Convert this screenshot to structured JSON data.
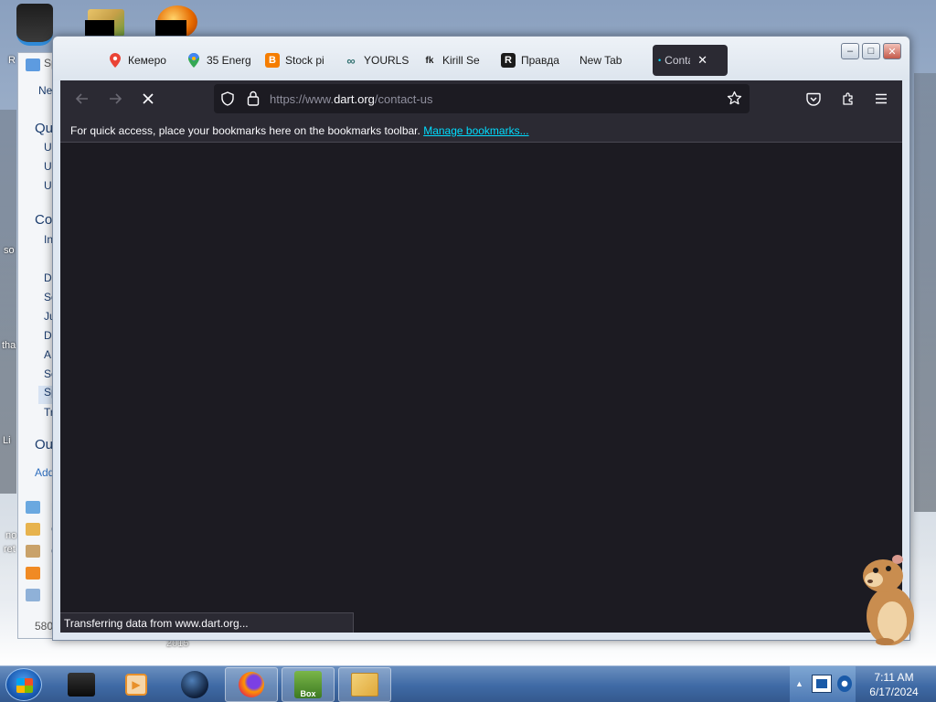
{
  "desktop": {
    "year_text": "2015",
    "side_texts": [
      "R",
      "so",
      "tha",
      "Li",
      "no",
      "ret"
    ]
  },
  "outlook_bg": {
    "top_label": "Sp",
    "menu_label": "Ne",
    "rows": [
      {
        "text": "Qu",
        "heading": true
      },
      {
        "text": "U"
      },
      {
        "text": "U"
      },
      {
        "text": "U"
      },
      {
        "text": "Co",
        "heading": true
      },
      {
        "text": "In"
      },
      {
        "text": "D"
      },
      {
        "text": "Se"
      },
      {
        "text": "Ju"
      },
      {
        "text": "D"
      },
      {
        "text": "A"
      },
      {
        "text": "Se"
      },
      {
        "text": "Sp",
        "selected": true
      },
      {
        "text": "Tr"
      },
      {
        "text": "Ou",
        "heading": true
      },
      {
        "text": "Add"
      }
    ],
    "nav_items": [
      "N",
      "C",
      "C",
      "F",
      "N"
    ],
    "footer": "580"
  },
  "browser": {
    "tabs": [
      {
        "label": "Кемеро",
        "icon": "map-pin-icon",
        "color": "#ea4335"
      },
      {
        "label": "35 Energ",
        "icon": "google-maps-icon",
        "color": "#34a853"
      },
      {
        "label": "Stock pi",
        "icon": "blogger-icon",
        "color": "#f57d00"
      },
      {
        "label": "YOURLS",
        "icon": "link-icon",
        "color": "#2f6f6f"
      },
      {
        "label": "Kirill Se",
        "icon": "fk-icon",
        "color": "#1b1b1b"
      },
      {
        "label": "Правда",
        "icon": "r-icon",
        "color": "#1b1b1b"
      },
      {
        "label": "New Tab",
        "icon": "",
        "color": ""
      }
    ],
    "active_tab": {
      "label": "Conta",
      "close": "✕"
    },
    "window_controls": {
      "minimize": "–",
      "maximize": "□",
      "close": "✕"
    },
    "url": {
      "prefix": "https://www.",
      "domain": "dart.org",
      "path": "/contact-us"
    },
    "bookmarks_bar": {
      "text": "For quick access, place your bookmarks here on the bookmarks toolbar.",
      "link": "Manage bookmarks..."
    },
    "status": "Transferring data from www.dart.org...",
    "colors": {
      "toolbar": "#2b2a33",
      "content": "#1c1b22",
      "link": "#00ddff"
    }
  },
  "taskbar": {
    "items": [
      {
        "name": "black-box-app-icon"
      },
      {
        "name": "media-player-icon"
      },
      {
        "name": "globe-app-icon"
      },
      {
        "name": "firefox-icon",
        "open": true
      },
      {
        "name": "box-game-icon",
        "open": true,
        "label": "Box"
      },
      {
        "name": "outlook-icon",
        "open": true
      }
    ],
    "time": "7:11 AM",
    "date": "6/17/2024"
  }
}
